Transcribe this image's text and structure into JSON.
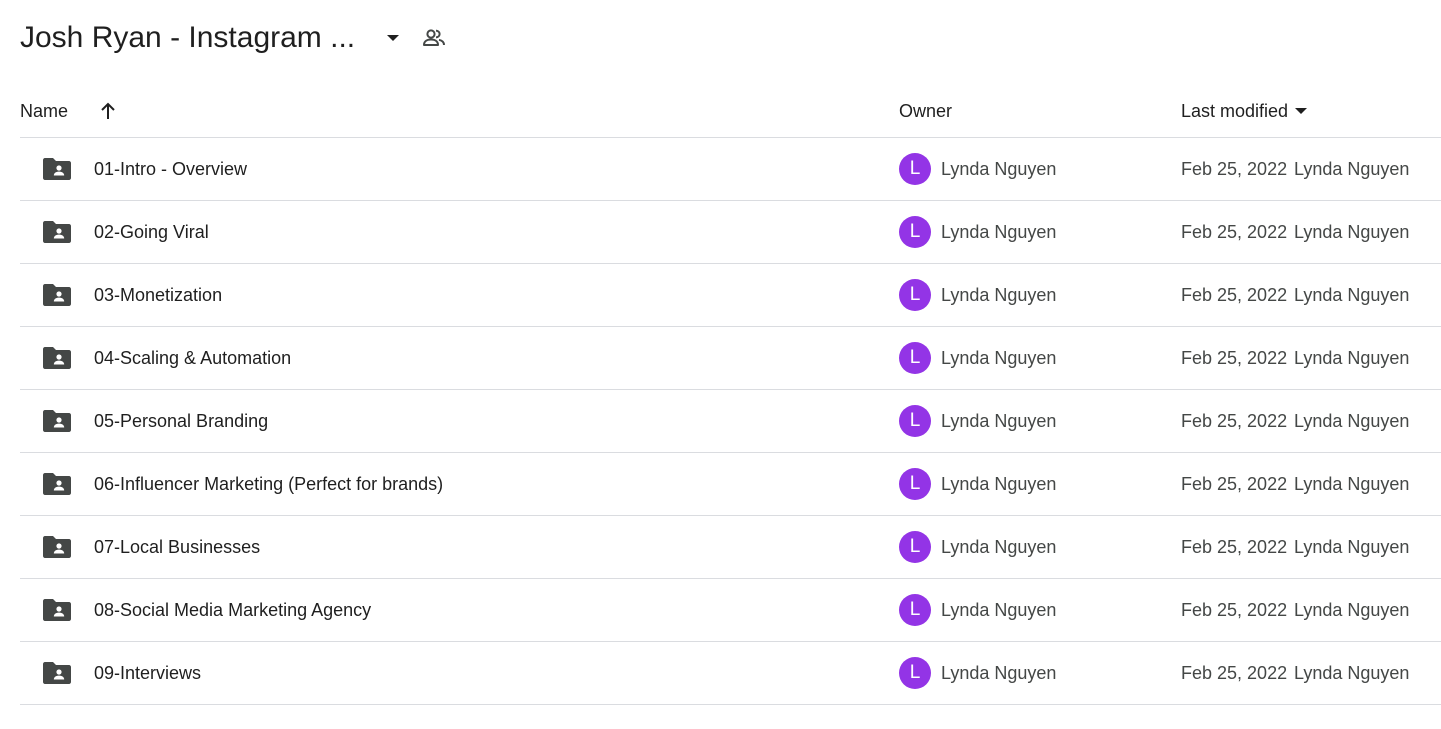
{
  "header": {
    "title": "Josh Ryan - Instagram ...",
    "dropdown_icon": "arrow-drop-down-icon",
    "shared_icon": "people-icon"
  },
  "columns": {
    "name": "Name",
    "owner": "Owner",
    "last_modified": "Last modified",
    "sort_icon": "arrow-upward-icon",
    "last_modified_icon": "arrow-drop-down-icon"
  },
  "colors": {
    "avatar_bg": "#9334e6",
    "folder_icon": "#444746",
    "divider": "#dadce0"
  },
  "rows": [
    {
      "name": "01-Intro - Overview",
      "icon": "shared-folder-icon",
      "owner_initial": "L",
      "owner": "Lynda Nguyen",
      "modified_date": "Feb 25, 2022",
      "modified_by": "Lynda Nguyen"
    },
    {
      "name": "02-Going Viral",
      "icon": "shared-folder-icon",
      "owner_initial": "L",
      "owner": "Lynda Nguyen",
      "modified_date": "Feb 25, 2022",
      "modified_by": "Lynda Nguyen"
    },
    {
      "name": "03-Monetization",
      "icon": "shared-folder-icon",
      "owner_initial": "L",
      "owner": "Lynda Nguyen",
      "modified_date": "Feb 25, 2022",
      "modified_by": "Lynda Nguyen"
    },
    {
      "name": "04-Scaling & Automation",
      "icon": "shared-folder-icon",
      "owner_initial": "L",
      "owner": "Lynda Nguyen",
      "modified_date": "Feb 25, 2022",
      "modified_by": "Lynda Nguyen"
    },
    {
      "name": "05-Personal Branding",
      "icon": "shared-folder-icon",
      "owner_initial": "L",
      "owner": "Lynda Nguyen",
      "modified_date": "Feb 25, 2022",
      "modified_by": "Lynda Nguyen"
    },
    {
      "name": "06-Influencer Marketing (Perfect for brands)",
      "icon": "shared-folder-icon",
      "owner_initial": "L",
      "owner": "Lynda Nguyen",
      "modified_date": "Feb 25, 2022",
      "modified_by": "Lynda Nguyen"
    },
    {
      "name": "07-Local Businesses",
      "icon": "shared-folder-icon",
      "owner_initial": "L",
      "owner": "Lynda Nguyen",
      "modified_date": "Feb 25, 2022",
      "modified_by": "Lynda Nguyen"
    },
    {
      "name": "08-Social Media Marketing Agency",
      "icon": "shared-folder-icon",
      "owner_initial": "L",
      "owner": "Lynda Nguyen",
      "modified_date": "Feb 25, 2022",
      "modified_by": "Lynda Nguyen"
    },
    {
      "name": "09-Interviews",
      "icon": "shared-folder-icon",
      "owner_initial": "L",
      "owner": "Lynda Nguyen",
      "modified_date": "Feb 25, 2022",
      "modified_by": "Lynda Nguyen"
    }
  ]
}
